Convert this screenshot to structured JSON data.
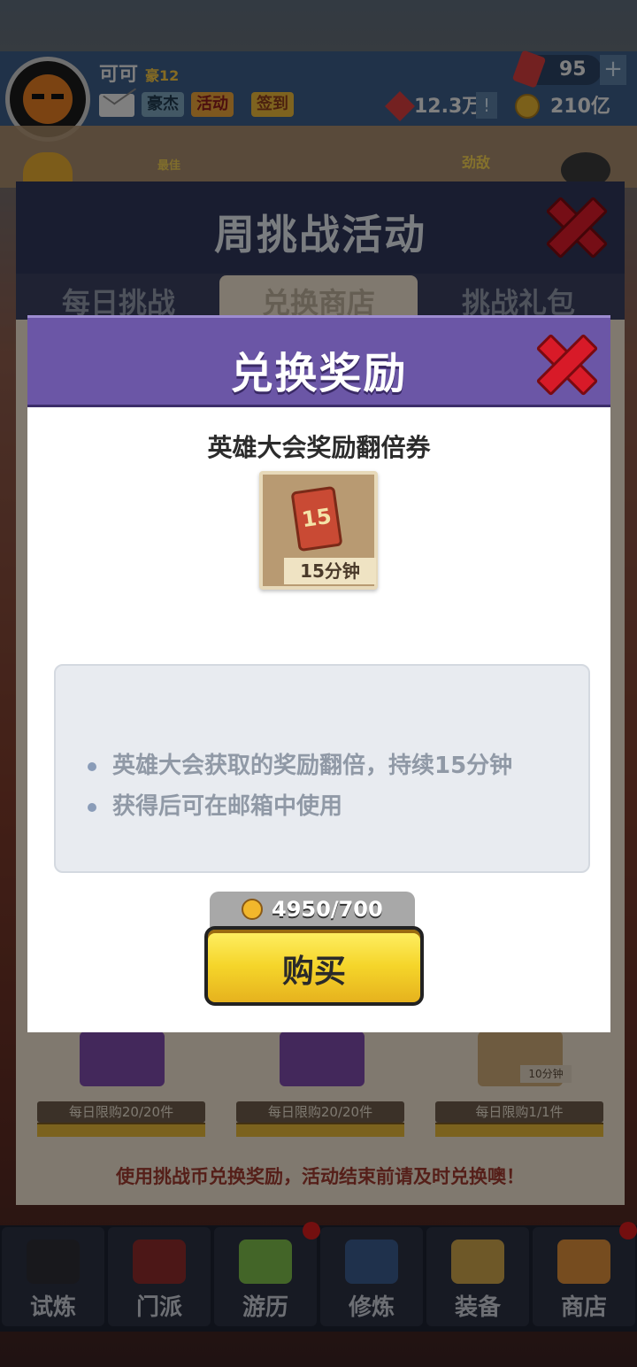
{
  "player": {
    "name": "可可",
    "rank": "豪12",
    "tags": [
      "豪杰",
      "活动",
      "签到"
    ]
  },
  "resources": {
    "gems": "95",
    "prestige": "12.3万",
    "coins": "210亿"
  },
  "background_labels": {
    "best": "最佳",
    "rival": "劲敌"
  },
  "weekly": {
    "title": "周挑战活动",
    "tabs": [
      "每日挑战",
      "兑换商店",
      "挑战礼包"
    ],
    "cards": [
      {
        "limit": "每日限购20/20件"
      },
      {
        "limit": "每日限购20/20件"
      },
      {
        "limit": "每日限购1/1件",
        "duration": "10分钟"
      }
    ],
    "footer": "使用挑战币兑换奖励，活动结束前请及时兑换噢！"
  },
  "nav": [
    "试炼",
    "门派",
    "游历",
    "修炼",
    "装备",
    "商店"
  ],
  "modal": {
    "title": "兑换奖励",
    "item_name": "英雄大会奖励翻倍券",
    "ticket_number": "15",
    "duration": "15分钟",
    "description": [
      "英雄大会获取的奖励翻倍，持续15分钟",
      "获得后可在邮箱中使用"
    ],
    "price": "4950/700",
    "buy_label": "购买"
  },
  "colors": {
    "modal_header": "#6b56a6",
    "close_red": "#d81a28",
    "buy_yellow": "#f5d52a"
  }
}
